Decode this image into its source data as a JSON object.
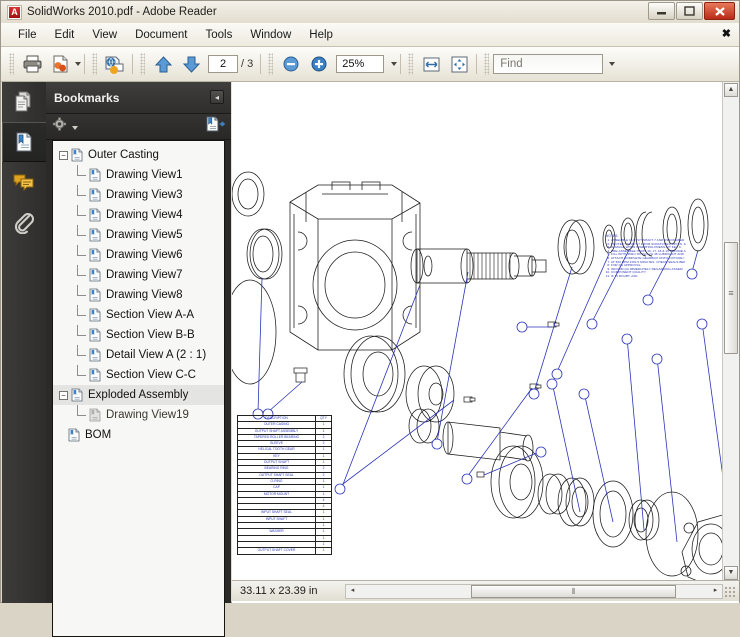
{
  "window": {
    "title": "SolidWorks 2010.pdf - Adobe Reader",
    "app_icon": "pdf-document-icon",
    "minimize": "−",
    "maximize": "❐",
    "close": "✕"
  },
  "menubar": {
    "items": [
      "File",
      "Edit",
      "View",
      "Document",
      "Tools",
      "Window",
      "Help"
    ],
    "close_label": "✖"
  },
  "toolbar": {
    "print": "print-icon",
    "email": "email-attach-icon",
    "create_pdf": "create-pdf-icon",
    "prev_page": "arrow-up-icon",
    "next_page": "arrow-down-icon",
    "page_current": "2",
    "page_total": "/ 3",
    "zoom_out": "zoom-out-icon",
    "zoom_in": "zoom-in-icon",
    "zoom_value": "25%",
    "fit_width": "fit-width-icon",
    "fit_page": "fit-page-icon",
    "find_placeholder": "Find"
  },
  "navstrip": {
    "items": [
      {
        "name": "pages-panel-icon",
        "label": "Pages",
        "selected": false
      },
      {
        "name": "bookmarks-panel-icon",
        "label": "Bookmarks",
        "selected": true
      },
      {
        "name": "comments-panel-icon",
        "label": "Comments",
        "selected": false
      },
      {
        "name": "attachments-panel-icon",
        "label": "Attachments",
        "selected": false
      }
    ]
  },
  "bookmarks": {
    "title": "Bookmarks",
    "collapse_glyph": "◂",
    "options_icon": "gear-icon",
    "new_bookmark_icon": "new-bookmark-icon",
    "tree": [
      {
        "label": "Outer Casting",
        "depth": 0,
        "expander": "−",
        "selected": false,
        "dim": false
      },
      {
        "label": "Drawing View1",
        "depth": 1,
        "expander": "",
        "selected": false,
        "dim": false
      },
      {
        "label": "Drawing View3",
        "depth": 1,
        "expander": "",
        "selected": false,
        "dim": false
      },
      {
        "label": "Drawing View4",
        "depth": 1,
        "expander": "",
        "selected": false,
        "dim": false
      },
      {
        "label": "Drawing View5",
        "depth": 1,
        "expander": "",
        "selected": false,
        "dim": false
      },
      {
        "label": "Drawing View6",
        "depth": 1,
        "expander": "",
        "selected": false,
        "dim": false
      },
      {
        "label": "Drawing View7",
        "depth": 1,
        "expander": "",
        "selected": false,
        "dim": false
      },
      {
        "label": "Drawing View8",
        "depth": 1,
        "expander": "",
        "selected": false,
        "dim": false
      },
      {
        "label": "Section View A-A",
        "depth": 1,
        "expander": "",
        "selected": false,
        "dim": false
      },
      {
        "label": "Section View B-B",
        "depth": 1,
        "expander": "",
        "selected": false,
        "dim": false
      },
      {
        "label": "Detail View A (2 : 1)",
        "depth": 1,
        "expander": "",
        "selected": false,
        "dim": false
      },
      {
        "label": "Section View C-C",
        "depth": 1,
        "expander": "",
        "selected": false,
        "dim": false
      },
      {
        "label": "Exploded Assembly",
        "depth": 0,
        "expander": "−",
        "selected": true,
        "dim": false
      },
      {
        "label": "Drawing View19",
        "depth": 1,
        "expander": "",
        "selected": false,
        "dim": true
      },
      {
        "label": "BOM",
        "depth": 0.5,
        "expander": "",
        "selected": false,
        "dim": false
      }
    ]
  },
  "document": {
    "notes_title": "NOTES:",
    "notes": [
      "ASSEMBLE OUTPUT SHAFT 7 AND ASSOCIATED",
      "PROTECT SHAFT 7 FROM SCRATCHES, NICKS, &",
      "DAMAGE WHEN INSERTING PRESS-FIT KEY 6.",
      "PRE-ASSEMBLE ITEMS 16, 17, 18 & 19 BEFORE A",
      "FILL WITH 350ml OF ISO-VG 46 LUBRICANT AND",
      "ATTACH COMPLETE GEARBOX ONTO FIXTURE I",
      "AT 500 RPM FOR 5 MINUTES. CHECK SEALS BEF",
      "FOR QA APPROVAL.",
      "INFORM QA IMMEDIATELY REGARDING ASSEM",
      "COMPONENT QUALITY.",
      "IF IN DOUBT, ASK."
    ],
    "bom_headers": [
      "DESCRIPTION",
      "QTY"
    ],
    "bom_rows": [
      [
        "OUTER CASING",
        "1"
      ],
      [
        "OUTPUT SHAFT ASSEMBLY",
        "1"
      ],
      [
        "TAPERED ROLLER BEARING",
        "2"
      ],
      [
        "SLEEVE",
        "2"
      ],
      [
        "HELICAL TOOTH GEAR",
        "1"
      ],
      [
        "KEY",
        "1"
      ],
      [
        "OUTPUT SHAFT",
        "1"
      ],
      [
        "BEARING RING",
        "2"
      ],
      [
        "OUTPUT SHAFT SEAL",
        "2"
      ],
      [
        "O-RING",
        "1"
      ],
      [
        "CAP",
        "1"
      ],
      [
        "MOTOR MOUNT",
        "1"
      ],
      [
        "",
        "4"
      ],
      [
        "",
        "4"
      ],
      [
        "INPUT SHAFT SEAL",
        "1"
      ],
      [
        "INPUT SHAFT",
        "1"
      ],
      [
        "",
        "1"
      ],
      [
        "WASHER",
        "1"
      ],
      [
        "",
        "1"
      ],
      [
        "",
        "1"
      ],
      [
        "OUTPUT SHAFT COVER",
        "1"
      ]
    ]
  },
  "status": {
    "dimensions": "33.11 x 23.39 in",
    "scroll_left": "◂",
    "scroll_right": "▸",
    "thumb_grip": "⦀"
  }
}
